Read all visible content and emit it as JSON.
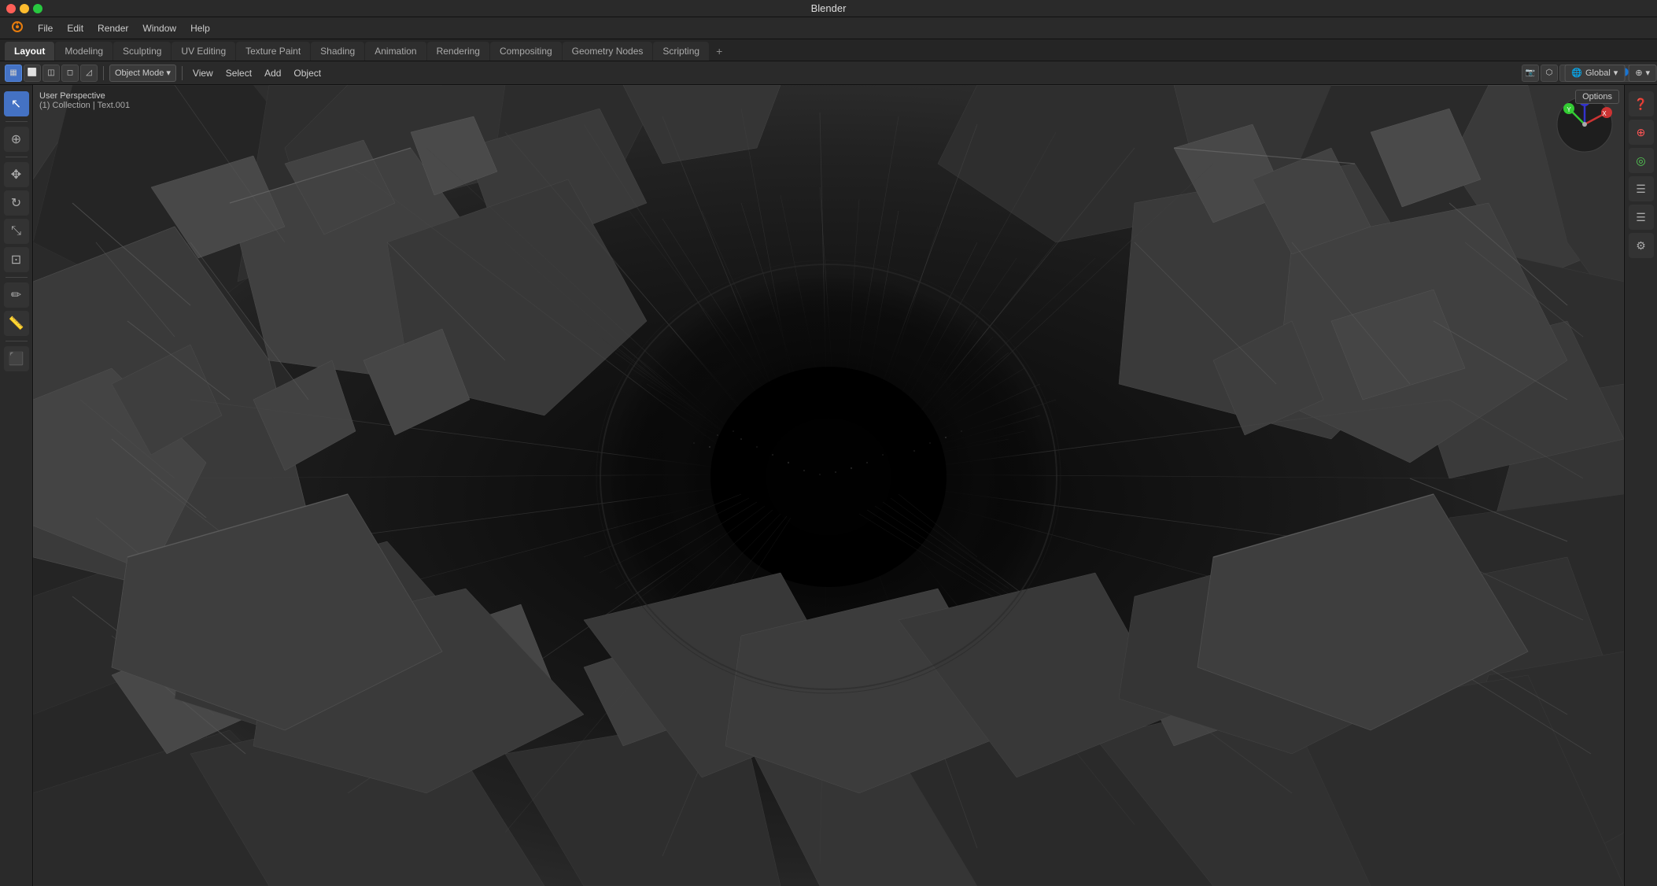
{
  "window": {
    "title": "Blender"
  },
  "menu_bar": {
    "items": [
      {
        "label": "Blender",
        "id": "blender-menu"
      },
      {
        "label": "File",
        "id": "file-menu"
      },
      {
        "label": "Edit",
        "id": "edit-menu"
      },
      {
        "label": "Render",
        "id": "render-menu"
      },
      {
        "label": "Window",
        "id": "window-menu"
      },
      {
        "label": "Help",
        "id": "help-menu"
      }
    ]
  },
  "workspace_tabs": {
    "tabs": [
      {
        "label": "Layout",
        "active": true
      },
      {
        "label": "Modeling",
        "active": false
      },
      {
        "label": "Sculpting",
        "active": false
      },
      {
        "label": "UV Editing",
        "active": false
      },
      {
        "label": "Texture Paint",
        "active": false
      },
      {
        "label": "Shading",
        "active": false
      },
      {
        "label": "Animation",
        "active": false
      },
      {
        "label": "Rendering",
        "active": false
      },
      {
        "label": "Compositing",
        "active": false
      },
      {
        "label": "Geometry Nodes",
        "active": false
      },
      {
        "label": "Scripting",
        "active": false
      }
    ],
    "add_label": "+"
  },
  "header_toolbar": {
    "mode_label": "Object Mode",
    "global_label": "Global",
    "pivot_label": "⊕",
    "snap_label": "🔽",
    "proportional_label": "◎",
    "icon_buttons": [
      "▦",
      "⬡",
      "☽",
      "✱"
    ],
    "left_icons": [
      "▦",
      "◫",
      "◻",
      "◿",
      "◳"
    ],
    "view_label": "View",
    "select_label": "Select",
    "add_label": "Add",
    "object_label": "Object"
  },
  "viewport_info": {
    "perspective_label": "User Perspective",
    "collection_label": "(1) Collection | Text.001"
  },
  "options_button": {
    "label": "Options"
  },
  "left_toolbar": {
    "tools": [
      {
        "icon": "↖",
        "name": "select",
        "active": true
      },
      {
        "icon": "⊕",
        "name": "cursor"
      },
      {
        "icon": "✥",
        "name": "move"
      },
      {
        "icon": "↻",
        "name": "rotate"
      },
      {
        "icon": "⤡",
        "name": "scale"
      },
      {
        "icon": "⊡",
        "name": "transform"
      },
      {
        "icon": "✏",
        "name": "annotate"
      },
      {
        "icon": "📊",
        "name": "measure"
      },
      {
        "icon": "⬛",
        "name": "add-cube"
      }
    ]
  },
  "right_toolbar": {
    "tools": [
      {
        "icon": "❓",
        "name": "info"
      },
      {
        "icon": "⊕",
        "name": "add-rotation"
      },
      {
        "icon": "◎",
        "name": "rotate-view"
      },
      {
        "icon": "☰",
        "name": "menu"
      },
      {
        "icon": "☰",
        "name": "tools"
      },
      {
        "icon": "⚙",
        "name": "settings"
      }
    ]
  },
  "nav_gizmo": {
    "x_color": "#ff4444",
    "y_color": "#44ff44",
    "z_color": "#4444ff",
    "x_label": "X",
    "y_label": "Y",
    "z_label": "Z"
  },
  "colors": {
    "bg_dark": "#1a1a1a",
    "panel_bg": "#2a2a2a",
    "tab_active": "#3c3c3c",
    "accent": "#4472c4",
    "border": "#111111",
    "text_primary": "#cccccc",
    "text_dim": "#888888"
  }
}
